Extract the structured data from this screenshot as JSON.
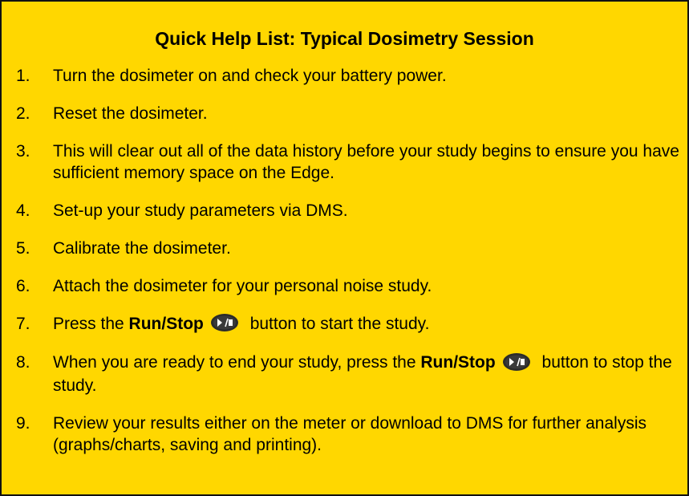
{
  "title": "Quick Help List:  Typical Dosimetry Session",
  "items": [
    {
      "num": "1.",
      "text": "Turn the dosimeter on and check your battery power."
    },
    {
      "num": "2.",
      "text": "Reset the dosimeter."
    },
    {
      "num": "3.",
      "text": "This will clear out all of the data history before your study begins to ensure you have sufficient memory space on the Edge."
    },
    {
      "num": "4.",
      "text": "Set-up your study parameters via DMS."
    },
    {
      "num": "5.",
      "text": "Calibrate the dosimeter."
    },
    {
      "num": "6.",
      "text": "Attach the dosimeter for your personal noise study."
    },
    {
      "num": "7.",
      "pre": "Press the ",
      "bold": "Run/Stop",
      "post": " button to start the study."
    },
    {
      "num": "8.",
      "pre": "When you are ready to end your study, press the ",
      "bold": "Run/Stop",
      "post": " button to stop the study."
    },
    {
      "num": "9.",
      "text": "Review your results either on the meter or download to DMS for further analysis (graphs/charts, saving and printing)."
    }
  ],
  "icons": {
    "run_stop": "run-stop-icon"
  },
  "colors": {
    "background": "#FFD700",
    "border": "#111111",
    "icon_fill": "#2b2b2b"
  }
}
